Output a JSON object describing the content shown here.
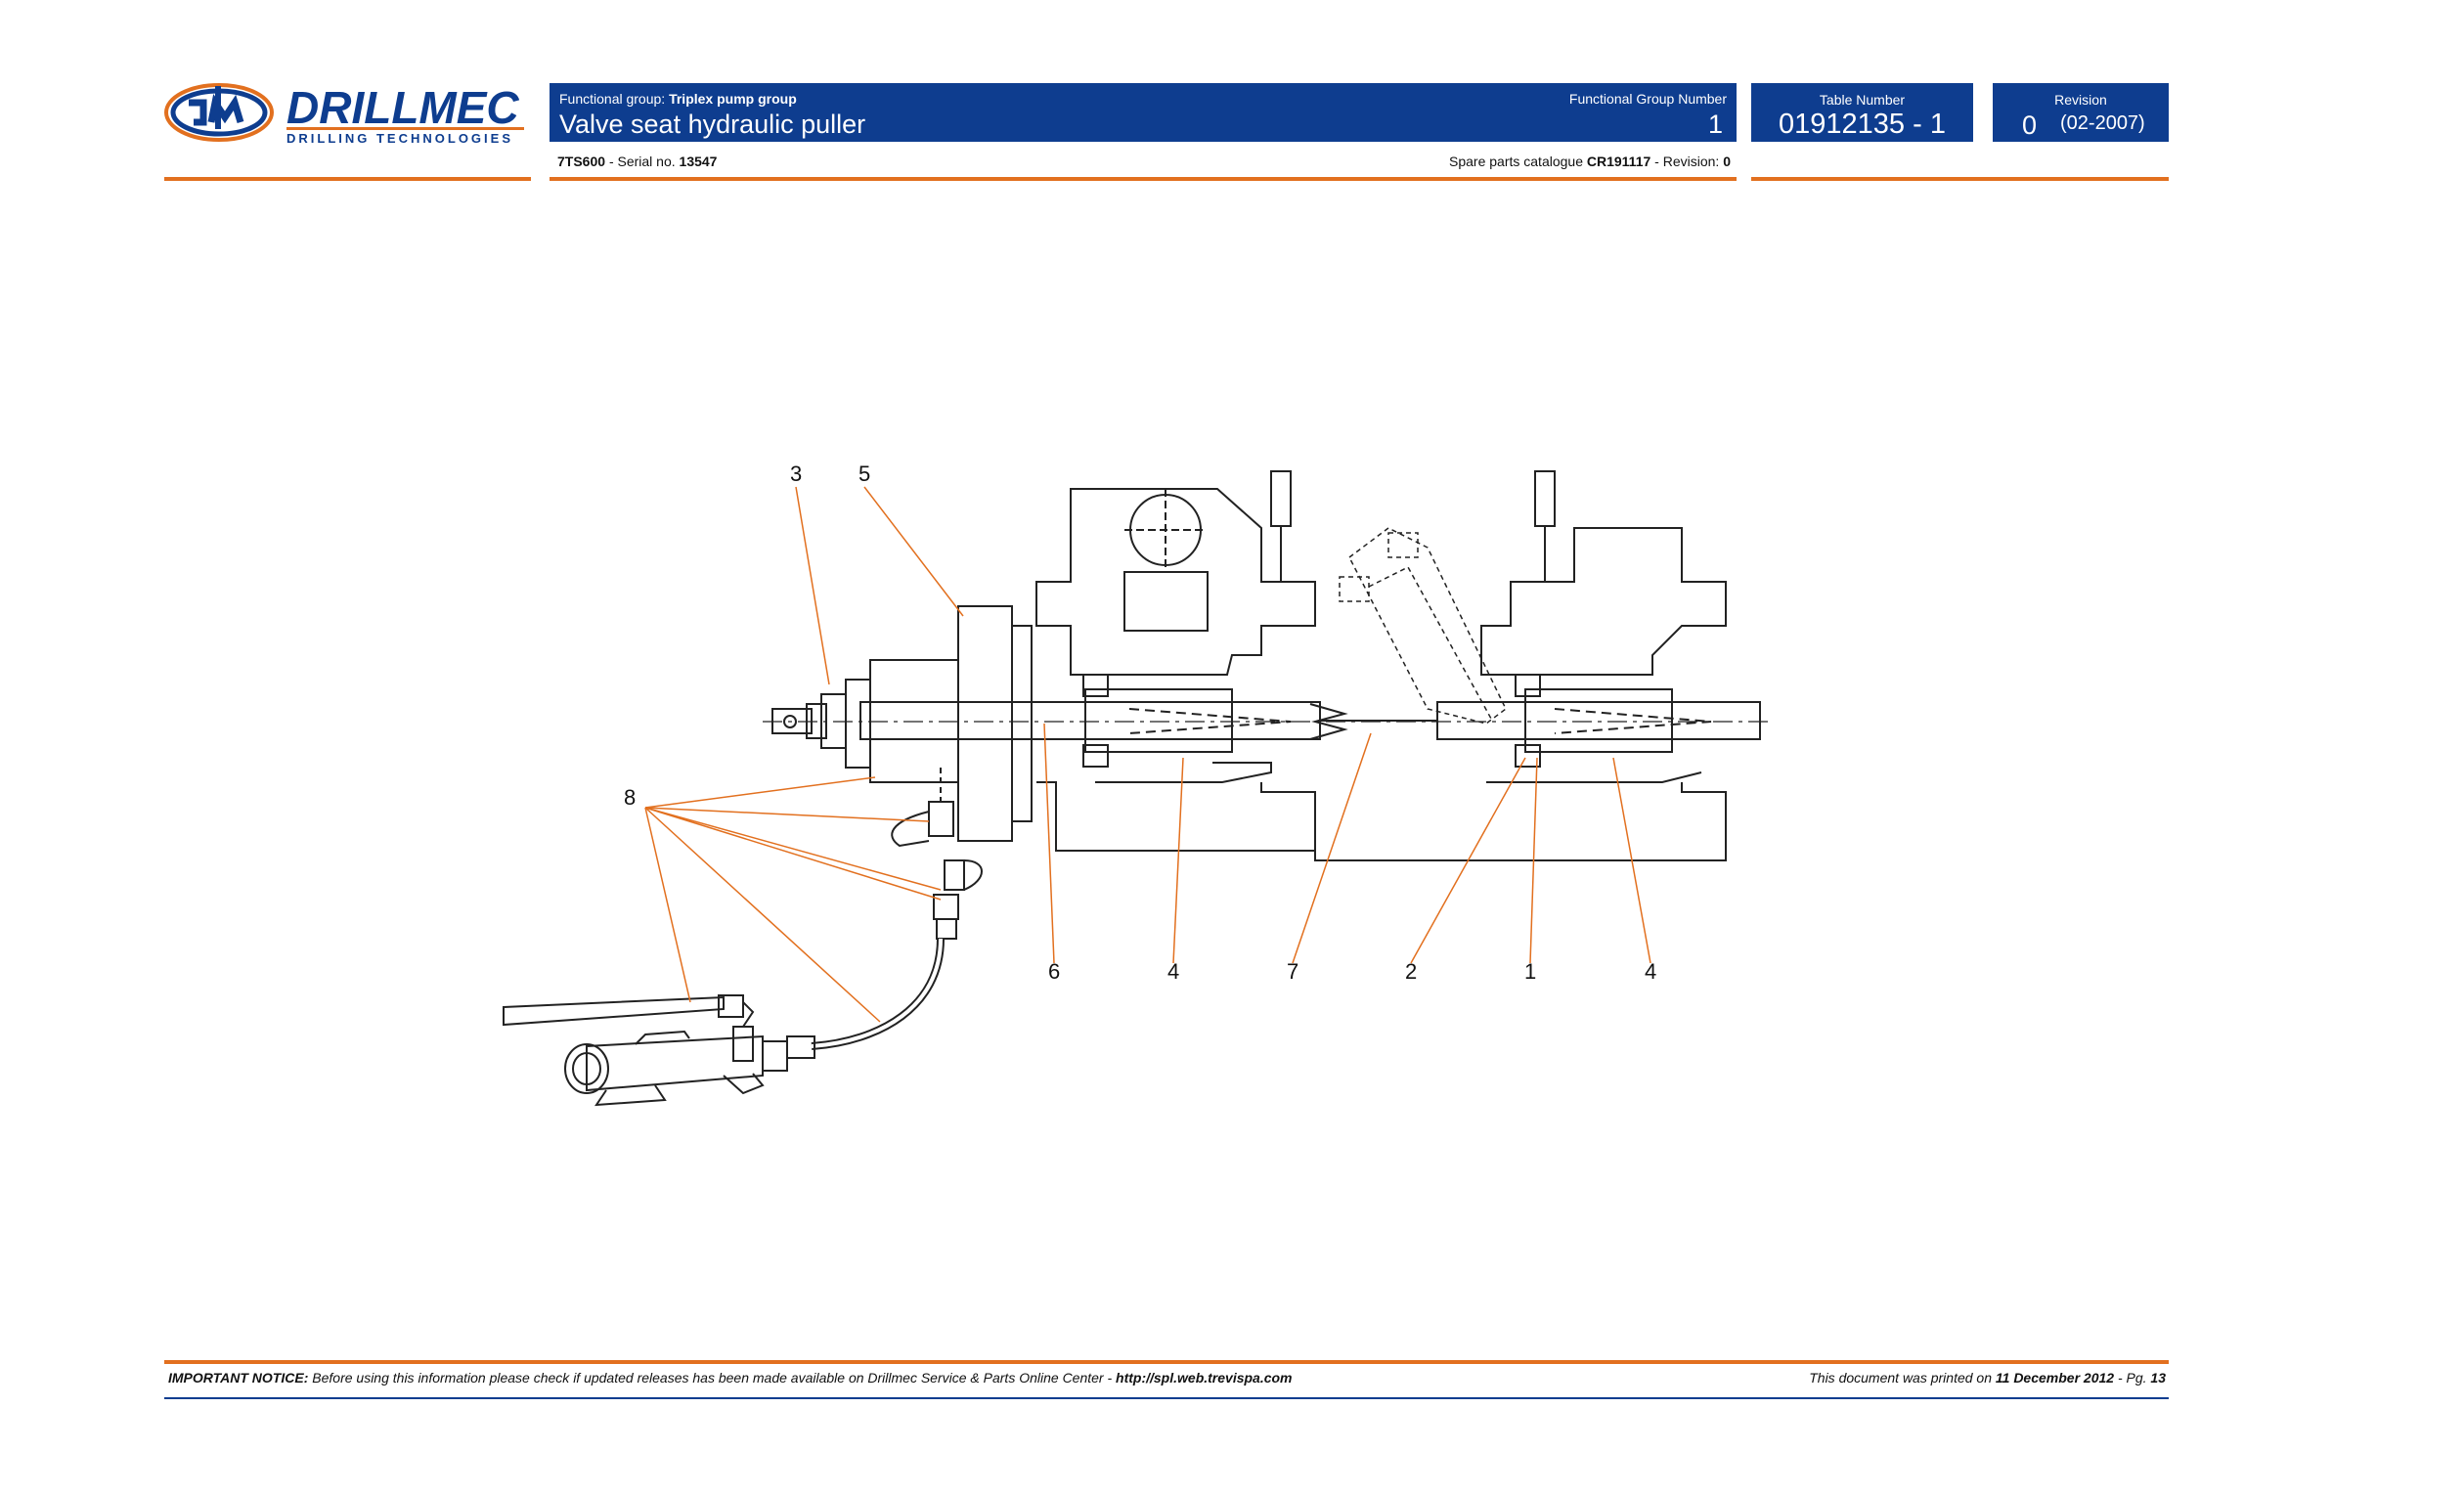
{
  "brand": {
    "name": "DRILLMEC",
    "tagline": "DRILLING TECHNOLOGIES",
    "colors": {
      "blue": "#0e3d8f",
      "orange": "#e2701f"
    }
  },
  "header": {
    "functional_group_label": "Functional group:",
    "functional_group": "Triplex pump group",
    "title": "Valve seat hydraulic puller",
    "functional_group_number_label": "Functional Group Number",
    "functional_group_number": "1",
    "table_number_label": "Table Number",
    "table_number": "01912135 - 1",
    "revision_label": "Revision",
    "revision": "0",
    "revision_date": "(02-2007)"
  },
  "info": {
    "model": "7TS600",
    "serial_label": "- Serial no.",
    "serial": "13547",
    "catalogue_label": "Spare parts catalogue",
    "catalogue": "CR191117",
    "catalogue_rev_label": "- Revision:",
    "catalogue_rev": "0"
  },
  "callouts": [
    "3",
    "5",
    "8",
    "6",
    "4",
    "7",
    "2",
    "1",
    "4"
  ],
  "footer": {
    "notice_label": "IMPORTANT NOTICE:",
    "notice_text": "Before using this information please check if updated releases has been made available on Drillmec Service & Parts Online Center -",
    "notice_url": "http://spl.web.trevispa.com",
    "printed_prefix": "This document was printed on",
    "printed_date": "11 December 2012",
    "page_label": "- Pg.",
    "page_number": "13"
  }
}
